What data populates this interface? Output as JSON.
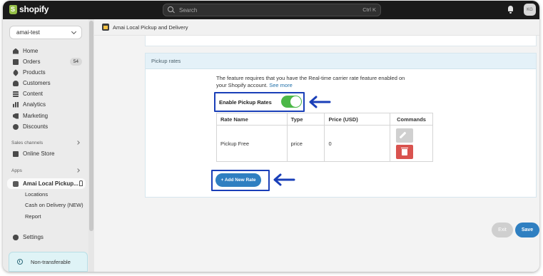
{
  "topbar": {
    "brand": "shopify",
    "search_placeholder": "Search",
    "search_shortcut": "Ctrl K",
    "avatar_initials": "KG"
  },
  "sidebar": {
    "store_name": "amai-test",
    "items": [
      {
        "label": "Home",
        "icon": "home-icon"
      },
      {
        "label": "Orders",
        "icon": "orders-icon",
        "badge": "54"
      },
      {
        "label": "Products",
        "icon": "products-icon"
      },
      {
        "label": "Customers",
        "icon": "customers-icon"
      },
      {
        "label": "Content",
        "icon": "content-icon"
      },
      {
        "label": "Analytics",
        "icon": "analytics-icon"
      },
      {
        "label": "Marketing",
        "icon": "marketing-icon"
      },
      {
        "label": "Discounts",
        "icon": "discounts-icon"
      }
    ],
    "sales_channels_label": "Sales channels",
    "online_store_label": "Online Store",
    "apps_label": "Apps",
    "app_label": "Amai Local Pickup...",
    "app_subitems": [
      "Locations",
      "Cash on Delivery (NEW)",
      "Report"
    ],
    "settings_label": "Settings",
    "non_transferable_label": "Non-transferable"
  },
  "main": {
    "app_title": "Amai Local Pickup and Delivery",
    "card_title": "Pickup rates",
    "feature_text": "The feature requires that you have the Real-time carrier rate feature enabled on your Shopify account.",
    "see_more": "See more",
    "enable_label": "Enable Pickup Rates",
    "toggle_on": true,
    "table": {
      "headers": [
        "Rate Name",
        "Type",
        "Price (USD)",
        "Commands"
      ],
      "rows": [
        {
          "name": "Pickup Free",
          "type": "price",
          "price": "0"
        }
      ]
    },
    "add_button": "+ Add New Rate",
    "exit_button": "Exit",
    "save_button": "Save"
  },
  "colors": {
    "accent": "#2f7fc1",
    "highlight_border": "#1a3fb8",
    "toggle_on": "#4cb848",
    "delete": "#d9534f"
  }
}
